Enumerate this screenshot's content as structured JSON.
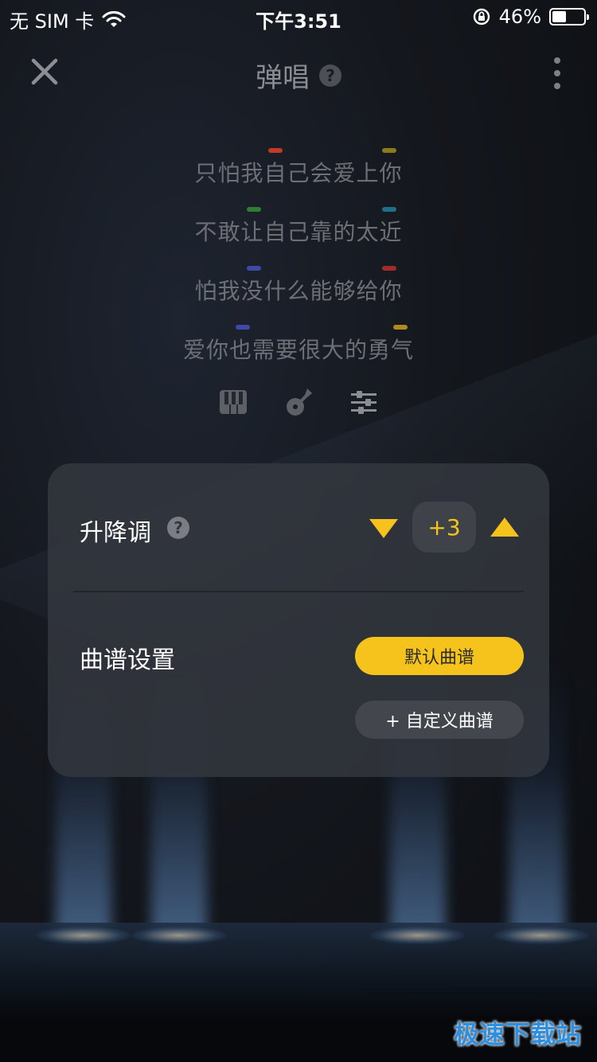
{
  "status_bar": {
    "carrier": "无 SIM 卡",
    "time": "下午3:51",
    "battery_percent_label": "46%",
    "battery_level": 0.46
  },
  "header": {
    "title": "弹唱",
    "help_glyph": "?",
    "close_icon": "close-icon",
    "more_icon": "more-vertical-icon"
  },
  "lyrics": [
    {
      "text": "只怕我自己会爱上你",
      "chords": [
        "#c0392b",
        "#8a7a1a"
      ]
    },
    {
      "text": "不敢让自己靠的太近",
      "chords": [
        "#2e7d32",
        "#1f6f8b"
      ]
    },
    {
      "text": "怕我没什么能够给你",
      "chords": [
        "#3f4aa8",
        "#a52a2a"
      ]
    },
    {
      "text": "爱你也需要很大的勇气",
      "chords": [
        "#3f4aa8",
        "#b08a1a"
      ]
    }
  ],
  "instruments": [
    "piano-icon",
    "guitar-icon",
    "mixer-icon"
  ],
  "panel": {
    "transpose_label": "升降调",
    "help_glyph": "?",
    "transpose_value": "+3",
    "score_label": "曲谱设置",
    "default_score_button": "默认曲谱",
    "custom_score_button": "+ 自定义曲谱"
  },
  "colors": {
    "accent": "#f5c31c",
    "panel_bg": "#34383f"
  },
  "watermark": "极速下载站"
}
